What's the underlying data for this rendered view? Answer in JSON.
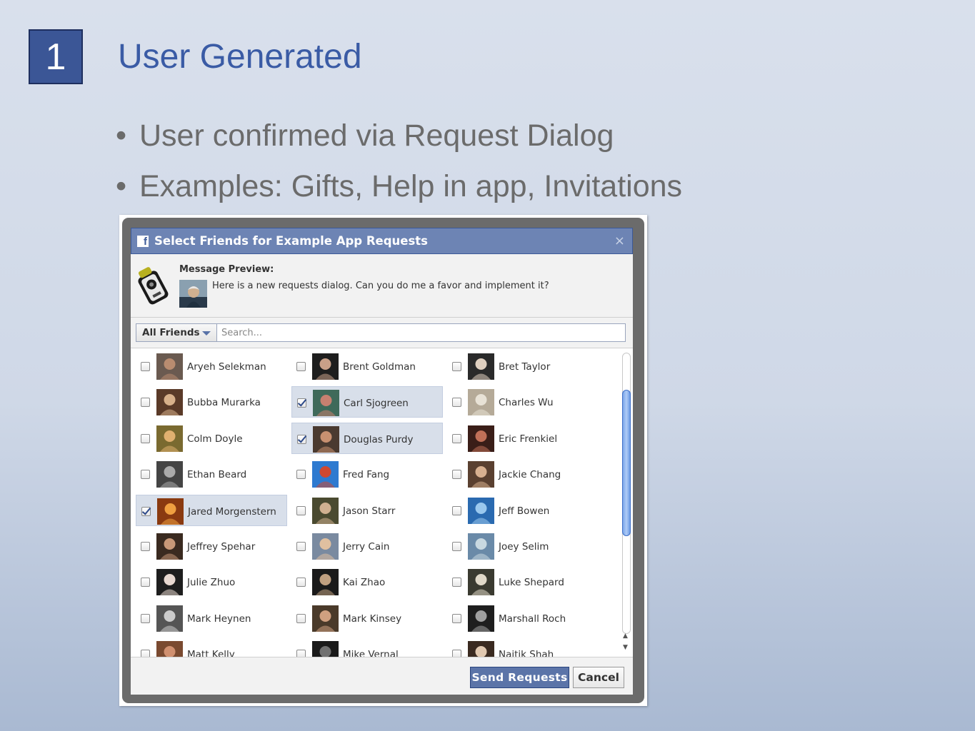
{
  "slide": {
    "number": "1",
    "title": "User Generated",
    "bullets": [
      "User confirmed via Request Dialog",
      "Examples: Gifts, Help in app, Invitations"
    ]
  },
  "dialog": {
    "title": "Select Friends for Example App Requests",
    "close_glyph": "×",
    "logo_glyph": "f",
    "preview_label": "Message Preview:",
    "preview_message": "Here is a new requests dialog. Can you do me a favor and implement it?",
    "filter_label": "All Friends",
    "search_placeholder": "Search...",
    "send_label": "Send Requests",
    "cancel_label": "Cancel",
    "scroll_up_glyph": "▲",
    "scroll_down_glyph": "▼",
    "friends": [
      {
        "name": "Aryeh Selekman",
        "checked": false,
        "c1": "#6a5a50",
        "c2": "#b98c70"
      },
      {
        "name": "Brent Goldman",
        "checked": false,
        "c1": "#1e1e1e",
        "c2": "#c9a088"
      },
      {
        "name": "Bret Taylor",
        "checked": false,
        "c1": "#2a2a2a",
        "c2": "#e0d0c0"
      },
      {
        "name": "Bubba Murarka",
        "checked": false,
        "c1": "#5a3a28",
        "c2": "#d7b08a"
      },
      {
        "name": "Carl Sjogreen",
        "checked": true,
        "c1": "#3f6a5a",
        "c2": "#c88070"
      },
      {
        "name": "Charles Wu",
        "checked": false,
        "c1": "#b5aa98",
        "c2": "#e8e2d6"
      },
      {
        "name": "Colm Doyle",
        "checked": false,
        "c1": "#7a6a30",
        "c2": "#e0b070"
      },
      {
        "name": "Douglas Purdy",
        "checked": true,
        "c1": "#4a3a30",
        "c2": "#c89070"
      },
      {
        "name": "Eric Frenkiel",
        "checked": false,
        "c1": "#3a1e18",
        "c2": "#c07058"
      },
      {
        "name": "Ethan Beard",
        "checked": false,
        "c1": "#444444",
        "c2": "#aaaaaa"
      },
      {
        "name": "Fred Fang",
        "checked": false,
        "c1": "#2e7ad0",
        "c2": "#d04830"
      },
      {
        "name": "Jackie Chang",
        "checked": false,
        "c1": "#5a4030",
        "c2": "#d8b090"
      },
      {
        "name": "Jared Morgenstern",
        "checked": true,
        "c1": "#8a3a10",
        "c2": "#f0a040"
      },
      {
        "name": "Jason Starr",
        "checked": false,
        "c1": "#4a4a30",
        "c2": "#d0b090"
      },
      {
        "name": "Jeff Bowen",
        "checked": false,
        "c1": "#2a6ab0",
        "c2": "#9ac8ee"
      },
      {
        "name": "Jeffrey Spehar",
        "checked": false,
        "c1": "#3a2a20",
        "c2": "#c89878"
      },
      {
        "name": "Jerry Cain",
        "checked": false,
        "c1": "#7a8aa0",
        "c2": "#e0c0a0"
      },
      {
        "name": "Joey Selim",
        "checked": false,
        "c1": "#6a8aa8",
        "c2": "#c8d8e0"
      },
      {
        "name": "Julie Zhuo",
        "checked": false,
        "c1": "#1e1e1e",
        "c2": "#e8d8d0"
      },
      {
        "name": "Kai Zhao",
        "checked": false,
        "c1": "#1a1a1a",
        "c2": "#c0a080"
      },
      {
        "name": "Luke Shepard",
        "checked": false,
        "c1": "#3a3a30",
        "c2": "#e0d8c8"
      },
      {
        "name": "Mark Heynen",
        "checked": false,
        "c1": "#555555",
        "c2": "#cccccc"
      },
      {
        "name": "Mark Kinsey",
        "checked": false,
        "c1": "#4a3a2a",
        "c2": "#d0a080"
      },
      {
        "name": "Marshall Roch",
        "checked": false,
        "c1": "#1e1e1e",
        "c2": "#a0a0a0"
      },
      {
        "name": "Matt Kelly",
        "checked": false,
        "c1": "#7a4a30",
        "c2": "#d09070"
      },
      {
        "name": "Mike Vernal",
        "checked": false,
        "c1": "#1a1a1a",
        "c2": "#707070"
      },
      {
        "name": "Naitik Shah",
        "checked": false,
        "c1": "#3a2a20",
        "c2": "#e0c8b0"
      }
    ]
  }
}
